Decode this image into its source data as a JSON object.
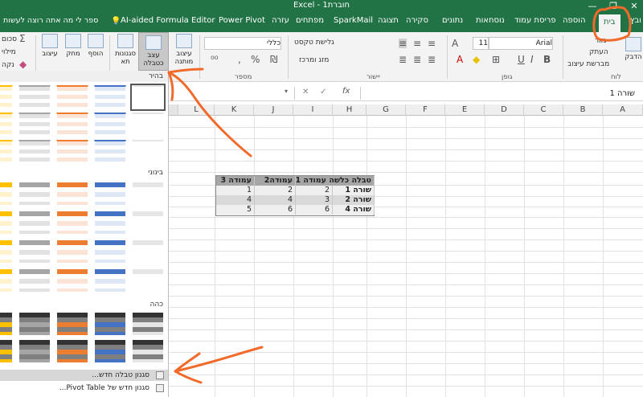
{
  "window": {
    "title": "Excel - חוברת1",
    "controls": [
      "—",
      "❐",
      "✕"
    ],
    "colors": {
      "excel_green": "#217346",
      "annotation_orange": "#f26a2a"
    }
  },
  "tabs": {
    "items": [
      "בית",
      "הוספה",
      "פריסת עמוד",
      "נוסחאות",
      "נתונים",
      "סקירה",
      "תצוגה",
      "SparkMail",
      "מפתחים",
      "עזרה",
      "Power Pivot",
      "AI-aided Formula Editor"
    ],
    "left_cut": "ובץ",
    "right_cut": "ספר לי מה אתה רוצה לעשות",
    "active": "בית"
  },
  "ribbon": {
    "clipboard": {
      "paste": "הדבק",
      "cut": "גזור",
      "copy": "העתק",
      "format_painter": "מברשת עיצוב",
      "group": "לוח"
    },
    "font": {
      "name": "Arial",
      "size": "11",
      "group": "גופן"
    },
    "alignment": {
      "wrap_text": "גלישת טקסט",
      "merge_center": "מזג ומרכז",
      "group": "יישור"
    },
    "number": {
      "format": "כללי",
      "group": "מספר"
    },
    "styles": {
      "cond_format": "עיצוב מותנה",
      "format_as_table": "עצב כטבלה",
      "cell_styles": "סגנונות תא"
    },
    "cells": {
      "insert": "הוסף",
      "delete": "מחק",
      "format": "עיצוב"
    },
    "editing": {
      "sum": "סכום",
      "fill": "מילוי",
      "clear": "נקה"
    }
  },
  "formula_bar": {
    "fx": "fx",
    "content": "שורה 1"
  },
  "grid": {
    "columns": [
      "A",
      "B",
      "C",
      "D",
      "E",
      "F",
      "G",
      "H",
      "I",
      "J",
      "K",
      "L"
    ],
    "table": {
      "header": [
        "טבלה כלשה עמודה 1",
        "עמודה2",
        "עמודה 3"
      ],
      "rows": [
        [
          "שורה 1",
          "2",
          "2",
          "1"
        ],
        [
          "שורה 2",
          "3",
          "4",
          "4"
        ],
        [
          "שורה 4",
          "6",
          "6",
          "5"
        ]
      ]
    }
  },
  "gallery": {
    "sections": [
      "בהיר",
      "בינוני",
      "כהה"
    ],
    "menu": [
      "סגנון טבלה חדש...",
      "סגנון חדש של Pivot Table..."
    ]
  }
}
